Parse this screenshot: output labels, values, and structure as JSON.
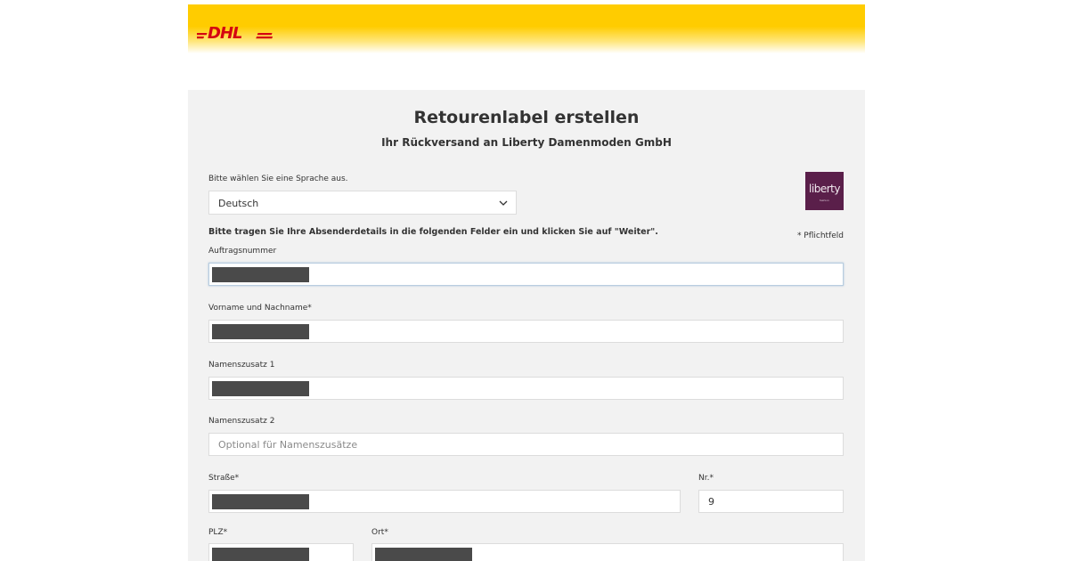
{
  "header": {
    "logo_text": "DHL",
    "brand_color": "#ffcc00",
    "logo_color": "#d40511"
  },
  "card": {
    "title": "Retourenlabel erstellen",
    "subtitle": "Ihr Rückversand an Liberty Damenmoden GmbH"
  },
  "language": {
    "label": "Bitte wählen Sie eine Sprache aus.",
    "selected": "Deutsch",
    "icon": "chevron-down-icon"
  },
  "merchant_logo": {
    "text": "liberty",
    "tagline": "fashion",
    "bg_color": "#5a1f4a"
  },
  "instructions": "Bitte tragen Sie Ihre Absenderdetails in die folgenden Felder ein und klicken Sie auf \"Weiter\".",
  "required_note": "* Pflichtfeld",
  "fields": {
    "order_number": {
      "label": "Auftragsnummer",
      "value": ""
    },
    "full_name": {
      "label": "Vorname und Nachname*",
      "value": ""
    },
    "name_extra_1": {
      "label": "Namenszusatz 1",
      "value": ""
    },
    "name_extra_2": {
      "label": "Namenszusatz 2",
      "placeholder": "Optional für Namenszusätze",
      "value": ""
    },
    "street": {
      "label": "Straße*",
      "value": ""
    },
    "house_number": {
      "label": "Nr.*",
      "value": "9"
    },
    "zip": {
      "label": "PLZ*",
      "value": ""
    },
    "city": {
      "label": "Ort*",
      "value": ""
    }
  }
}
